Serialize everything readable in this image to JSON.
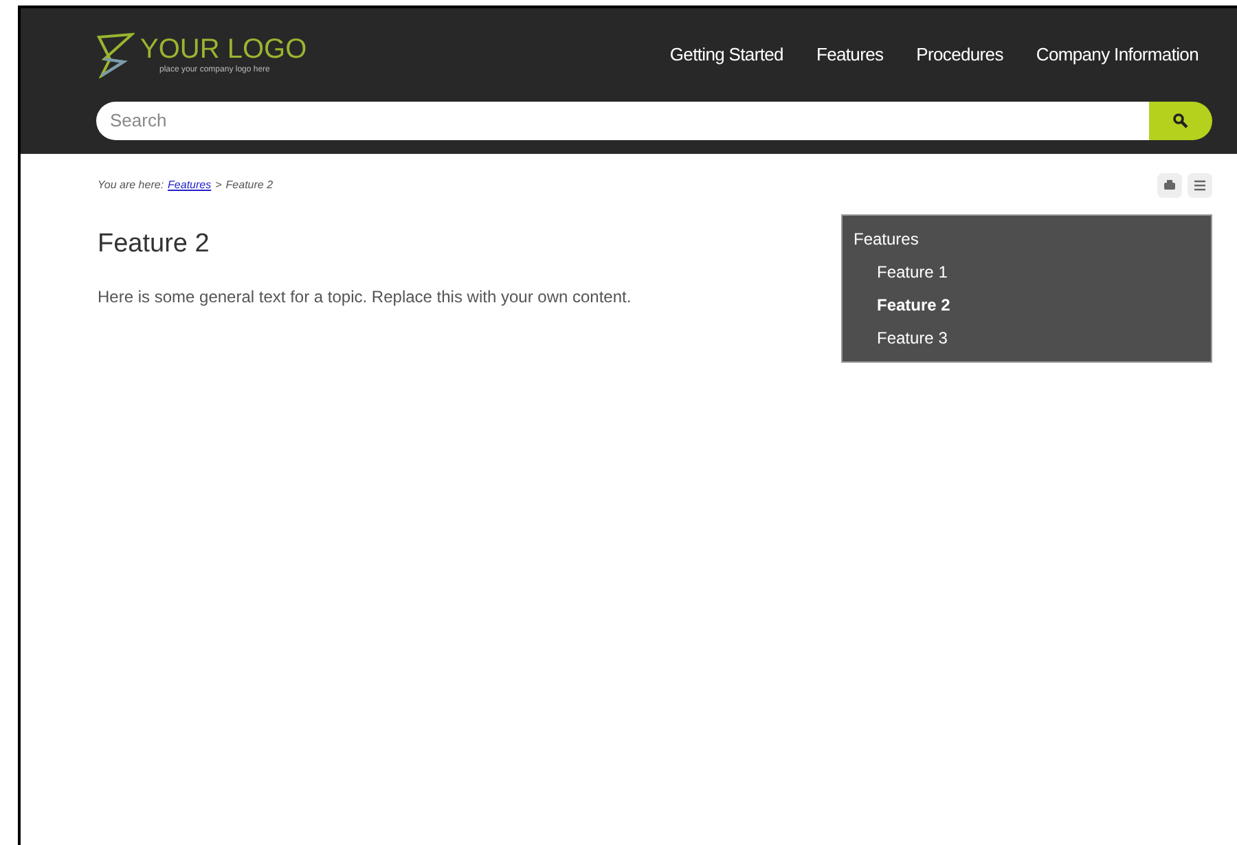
{
  "logo": {
    "title": "YOUR LOGO",
    "tagline": "place your company logo here"
  },
  "nav": [
    {
      "label": "Getting Started"
    },
    {
      "label": "Features"
    },
    {
      "label": "Procedures"
    },
    {
      "label": "Company Information"
    }
  ],
  "search": {
    "placeholder": "Search"
  },
  "breadcrumb": {
    "prefix": "You are here:",
    "link": "Features",
    "separator": ">",
    "current": "Feature 2"
  },
  "article": {
    "title": "Feature 2",
    "body": "Here is some general text for a topic. Replace this with your own content."
  },
  "sidebar": {
    "title": "Features",
    "items": [
      {
        "label": "Feature 1",
        "selected": false
      },
      {
        "label": "Feature 2",
        "selected": true
      },
      {
        "label": "Feature 3",
        "selected": false
      }
    ]
  }
}
